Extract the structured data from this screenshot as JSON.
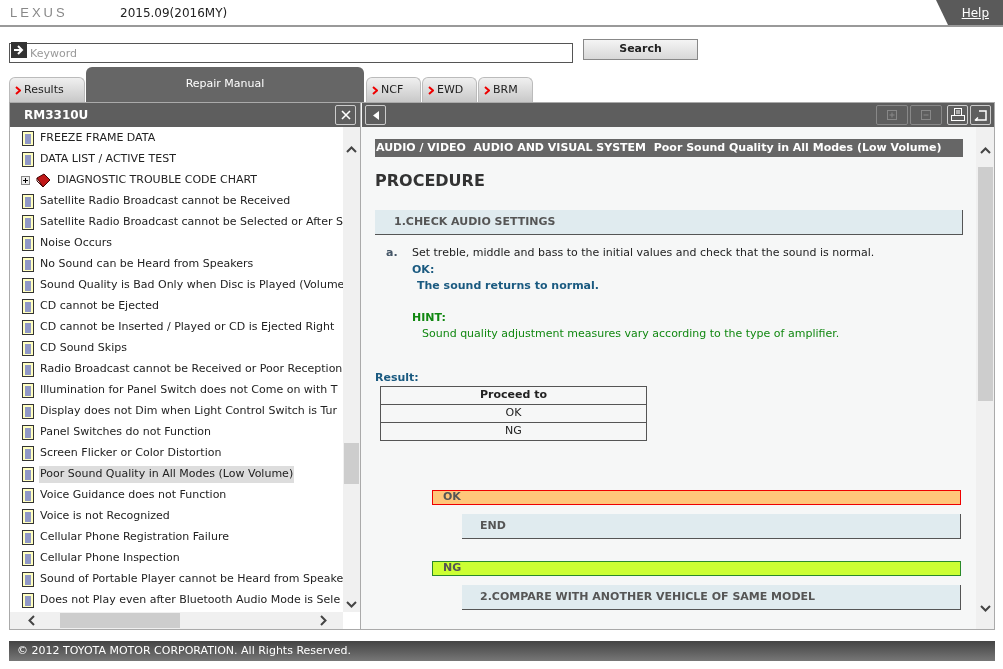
{
  "header": {
    "logo": "LEXUS",
    "version": "2015.09(2016MY)",
    "help_link": "Help"
  },
  "search": {
    "placeholder": "Keyword",
    "button": "Search"
  },
  "tabs": [
    {
      "label": "Results",
      "selected": false
    },
    {
      "label": "Repair Manual",
      "selected": true
    },
    {
      "label": "NCF",
      "selected": false
    },
    {
      "label": "EWD",
      "selected": false
    },
    {
      "label": "BRM",
      "selected": false
    }
  ],
  "left_panel": {
    "title": "RM3310U",
    "tree": [
      {
        "kind": "document",
        "label": "FREEZE FRAME DATA",
        "selected": false
      },
      {
        "kind": "document",
        "label": "DATA LIST / ACTIVE TEST",
        "selected": false
      },
      {
        "kind": "book",
        "label": "DIAGNOSTIC TROUBLE CODE CHART",
        "selected": false,
        "expanded": false
      },
      {
        "kind": "document",
        "label": "Satellite Radio Broadcast cannot be Received",
        "selected": false
      },
      {
        "kind": "document",
        "label": "Satellite Radio Broadcast cannot be Selected or After S",
        "selected": false
      },
      {
        "kind": "document",
        "label": "Noise Occurs",
        "selected": false
      },
      {
        "kind": "document",
        "label": "No Sound can be Heard from Speakers",
        "selected": false
      },
      {
        "kind": "document",
        "label": "Sound Quality is Bad Only when Disc is Played (Volume",
        "selected": false
      },
      {
        "kind": "document",
        "label": "CD cannot be Ejected",
        "selected": false
      },
      {
        "kind": "document",
        "label": "CD cannot be Inserted / Played or CD is Ejected Right",
        "selected": false
      },
      {
        "kind": "document",
        "label": "CD Sound Skips",
        "selected": false
      },
      {
        "kind": "document",
        "label": "Radio Broadcast cannot be Received or Poor Reception",
        "selected": false
      },
      {
        "kind": "document",
        "label": "Illumination for Panel Switch does not Come on with T",
        "selected": false
      },
      {
        "kind": "document",
        "label": "Display does not Dim when Light Control Switch is Tur",
        "selected": false
      },
      {
        "kind": "document",
        "label": "Panel Switches do not Function",
        "selected": false
      },
      {
        "kind": "document",
        "label": "Screen Flicker or Color Distortion",
        "selected": false
      },
      {
        "kind": "document",
        "label": "Poor Sound Quality in All Modes (Low Volume)",
        "selected": true
      },
      {
        "kind": "document",
        "label": "Voice Guidance does not Function",
        "selected": false
      },
      {
        "kind": "document",
        "label": "Voice is not Recognized",
        "selected": false
      },
      {
        "kind": "document",
        "label": "Cellular Phone Registration Failure",
        "selected": false
      },
      {
        "kind": "document",
        "label": "Cellular Phone Inspection",
        "selected": false
      },
      {
        "kind": "document",
        "label": "Sound of Portable Player cannot be Heard from Speake",
        "selected": false
      },
      {
        "kind": "document",
        "label": "Does not Play even after Bluetooth Audio Mode is Sele",
        "selected": false
      }
    ]
  },
  "toolbar": [
    {
      "kind": "expand",
      "disabled": true
    },
    {
      "kind": "collapse",
      "disabled": true
    },
    {
      "kind": "print",
      "disabled": false
    },
    {
      "kind": "return",
      "disabled": false
    }
  ],
  "content": {
    "breadcrumb": "AUDIO / VIDEO  AUDIO AND VISUAL SYSTEM  Poor Sound Quality in All Modes (Low Volume)",
    "heading": "PROCEDURE",
    "step": "1.CHECK AUDIO SETTINGS",
    "instruction": {
      "marker": "a.",
      "text": "Set treble, middle and bass to the initial values and check that the sound is normal.",
      "ok_label": "OK:",
      "ok_text": "The sound returns to normal.",
      "hint_label": "HINT:",
      "hint_text": "Sound quality adjustment measures vary according to the type of amplifier."
    },
    "result_label": "Result:",
    "result_table": {
      "header": "Proceed to",
      "rows": [
        "OK",
        "NG"
      ]
    },
    "branches": [
      {
        "kind": "ok",
        "label": "OK",
        "next": "END"
      },
      {
        "kind": "ng",
        "label": "NG",
        "next": "2.COMPARE WITH ANOTHER VEHICLE OF SAME MODEL"
      }
    ]
  },
  "footer": "© 2012 TOYOTA MOTOR CORPORATION. All Rights Reserved."
}
